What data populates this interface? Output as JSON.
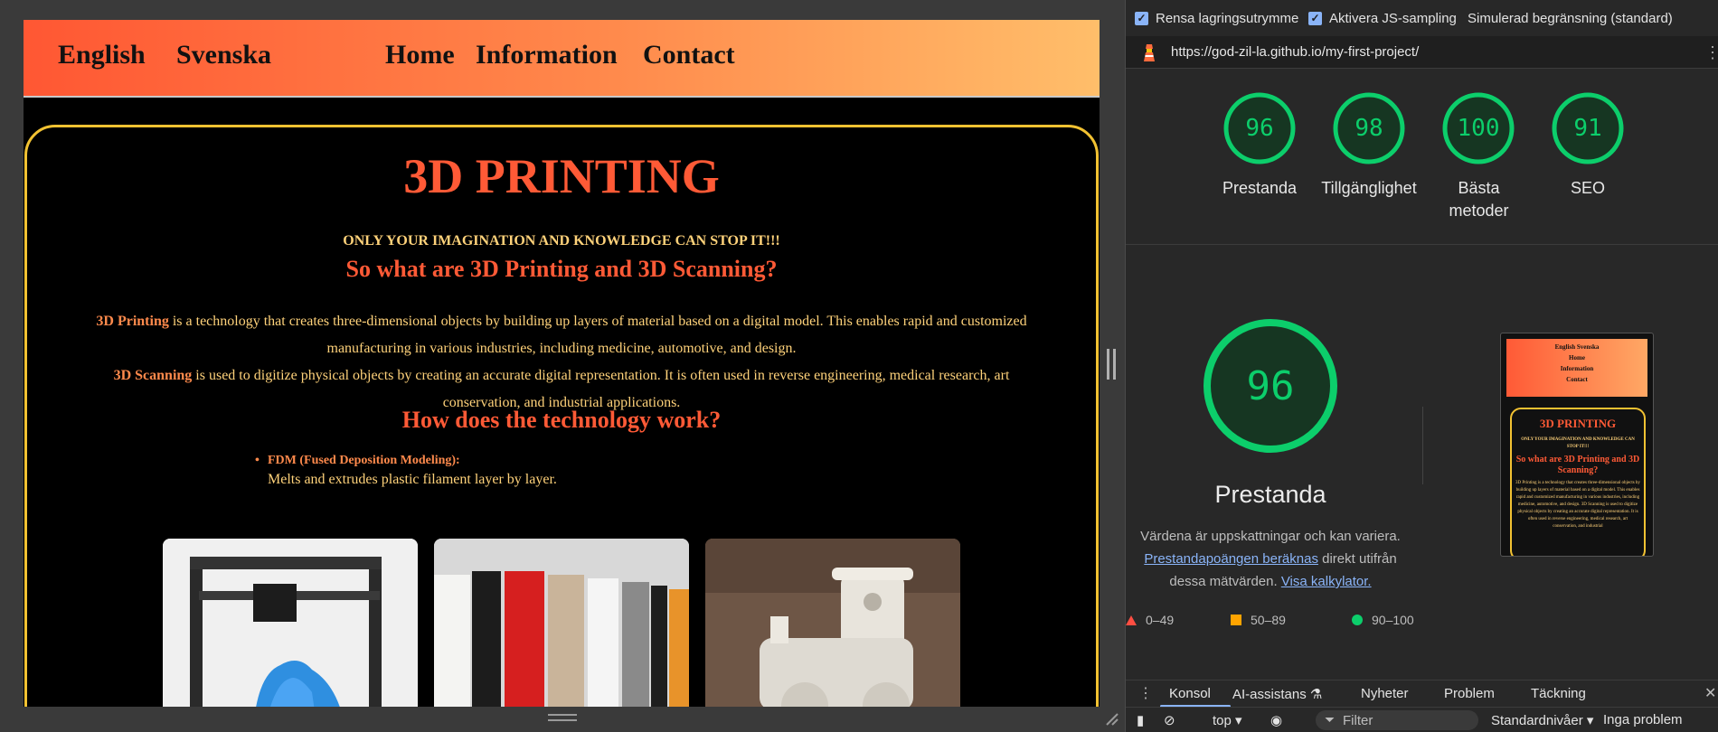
{
  "site": {
    "nav": {
      "lang_en": "English",
      "lang_sv": "Svenska",
      "home": "Home",
      "information": "Information",
      "contact": "Contact"
    },
    "title": "3D PRINTING",
    "tagline": "ONLY YOUR IMAGINATION AND KNOWLEDGE CAN STOP IT!!!",
    "heading_what": "So what are 3D Printing and 3D Scanning?",
    "para1_term": "3D Printing",
    "para1_text": " is a technology that creates three-dimensional objects by building up layers of material based on a digital model. This enables rapid and customized manufacturing in various industries, including medicine, automotive, and design.",
    "para2_term": "3D Scanning",
    "para2_text": " is used to digitize physical objects by creating an accurate digital representation. It is often used in reverse engineering, medical research, art conservation, and industrial applications.",
    "heading_how": "How does the technology work?",
    "fdm_term": "FDM (Fused Deposition Modeling):",
    "fdm_desc": "Melts and extrudes plastic filament layer by layer.",
    "photos": [
      "3d-printer-photo",
      "filament-spools-photo",
      "printed-train-photo"
    ]
  },
  "devtools": {
    "options": {
      "clear_storage": "Rensa lagringsutrymme",
      "js_sampling": "Aktivera JS-sampling",
      "throttling": "Simulerad begränsning (standard)"
    },
    "url": "https://god-zil-la.github.io/my-first-project/",
    "scores": [
      {
        "value": "96",
        "label": "Prestanda"
      },
      {
        "value": "98",
        "label": "Tillgänglighet"
      },
      {
        "value": "100",
        "label": "Bästa metoder"
      },
      {
        "value": "91",
        "label": "SEO"
      }
    ],
    "main_score": "96",
    "main_title": "Prestanda",
    "desc_part1": "Värdena är uppskattningar och kan variera.",
    "desc_link1": "Prestandapoängen beräknas",
    "desc_part2": " direkt utifrån dessa mätvärden.",
    "desc_link2": "Visa kalkylator.",
    "legend": {
      "poor": "0–49",
      "average": "50–89",
      "good": "90–100"
    },
    "thumbnail": {
      "nav": "English    Svenska",
      "nav_home": "Home",
      "nav_info": "Information",
      "nav_contact": "Contact",
      "title": "3D PRINTING",
      "tagline": "ONLY YOUR IMAGINATION AND KNOWLEDGE CAN STOP IT!!!",
      "heading": "So what are 3D Printing and 3D Scanning?",
      "text": "3D Printing is a technology that creates three-dimensional objects by building up layers of material based on a digital model. This enables rapid and customized manufacturing in various industries, including medicine, automotive, and design. 3D Scanning is used to digitize physical objects by creating an accurate digital representation. It is often used in reverse engineering, medical research, art conservation, and industrial"
    },
    "drawer_tabs": {
      "console": "Konsol",
      "ai": "AI-assistans",
      "news": "Nyheter",
      "problems": "Problem",
      "coverage": "Täckning"
    },
    "console_bar": {
      "context": "top",
      "filter": "Filter",
      "levels": "Standardnivåer",
      "issues": "Inga problem"
    },
    "colors": {
      "good": "#0cce6b",
      "average": "#ffa400",
      "poor": "#ff4e42",
      "accent": "#ff5a36"
    }
  }
}
